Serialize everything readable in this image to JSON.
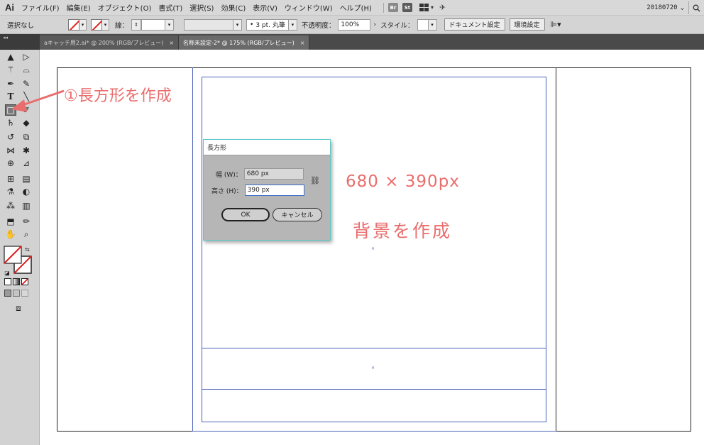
{
  "app": {
    "logo": "Ai"
  },
  "menubar": {
    "items": [
      "ファイル(F)",
      "編集(E)",
      "オブジェクト(O)",
      "書式(T)",
      "選択(S)",
      "効果(C)",
      "表示(V)",
      "ウィンドウ(W)",
      "ヘルプ(H)"
    ],
    "badge_br": "Br",
    "badge_st": "St",
    "workspace": "20180720",
    "workspace_caret": "⌄",
    "search_icon": "search-icon"
  },
  "controlbar": {
    "selection": "選択なし",
    "stroke_label": "線：",
    "stroke_style": "3 pt. 丸筆",
    "opacity_label": "不透明度：",
    "opacity_value": "100%",
    "style_label": "スタイル：",
    "doc_settings": "ドキュメント設定",
    "prefs": "環境設定",
    "fill_color": "none",
    "stroke_color": "none"
  },
  "tabs": [
    {
      "label": "aキャッチ用2.ai* @ 200% (RGB/プレビュー)",
      "active": false
    },
    {
      "label": "名称未設定-2* @ 175% (RGB/プレビュー)",
      "active": true
    }
  ],
  "tab_close": "×",
  "dialog": {
    "title": "長方形",
    "width_label": "幅 (W)：",
    "width_value": "680 px",
    "height_label": "高さ (H)：",
    "height_value": "390 px",
    "ok": "OK",
    "cancel": "キャンセル"
  },
  "annotations": {
    "step": "①長方形を作成",
    "size": "680 × 390px",
    "note": "背景を作成"
  },
  "colors": {
    "annotation": "#ea6d6d",
    "guide": "#4a62b8",
    "dialog_border": "#5ac9c9"
  }
}
